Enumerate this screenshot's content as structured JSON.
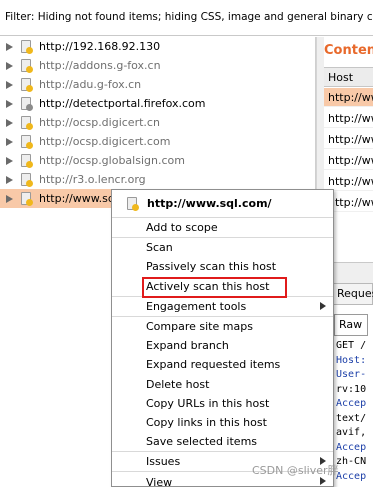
{
  "filter": {
    "text": "Filter: Hiding not found items;  hiding CSS, image and general binary content;  hi"
  },
  "tree": {
    "items": [
      {
        "label": "http://192.168.92.130",
        "style": "black",
        "dot": "#f0b81c"
      },
      {
        "label": "http://addons.g-fox.cn",
        "style": "grey",
        "dot": "#f0b81c"
      },
      {
        "label": "http://adu.g-fox.cn",
        "style": "grey",
        "dot": "#f0b81c"
      },
      {
        "label": "http://detectportal.firefox.com",
        "style": "black",
        "dot": "#8c8c8c"
      },
      {
        "label": "http://ocsp.digicert.cn",
        "style": "grey",
        "dot": "#f0b81c"
      },
      {
        "label": "http://ocsp.digicert.com",
        "style": "grey",
        "dot": "#f0b81c"
      },
      {
        "label": "http://ocsp.globalsign.com",
        "style": "grey",
        "dot": "#f0b81c"
      },
      {
        "label": "http://r3.o.lencr.org",
        "style": "grey",
        "dot": "#f0b81c"
      },
      {
        "label": "http://www.sq",
        "style": "black",
        "dot": "#f0b81c",
        "selected": true
      }
    ]
  },
  "right_pane": {
    "title": "Contents",
    "column_header": "Host",
    "rows": [
      "http://ww",
      "http://ww",
      "http://ww",
      "http://ww",
      "http://ww",
      "http://ww"
    ],
    "request_tab": "Request",
    "raw_tab": "Raw",
    "code_lines": [
      "GET /",
      "Host:",
      "User-",
      "rv:10",
      "Accep",
      "text/",
      "avif,",
      "Accep",
      "zh-CN",
      "Accep"
    ]
  },
  "context_menu": {
    "header": "http://www.sql.com/",
    "groups": [
      [
        "Add to scope"
      ],
      [
        "Scan",
        "Passively scan this host",
        "Actively scan this host"
      ],
      [
        "Engagement tools"
      ],
      [
        "Compare site maps",
        "Expand branch",
        "Expand requested items",
        "Delete host",
        "Copy URLs in this host",
        "Copy links in this host",
        "Save selected items"
      ],
      [
        "Issues"
      ],
      [
        "View"
      ]
    ],
    "submenus": [
      "Engagement tools",
      "Issues",
      "View"
    ]
  },
  "watermark": "CSDN @sliver胖",
  "colors": {
    "accent": "#e8692b",
    "selection": "#f8c9a8",
    "highlight": "#e01b1b"
  }
}
